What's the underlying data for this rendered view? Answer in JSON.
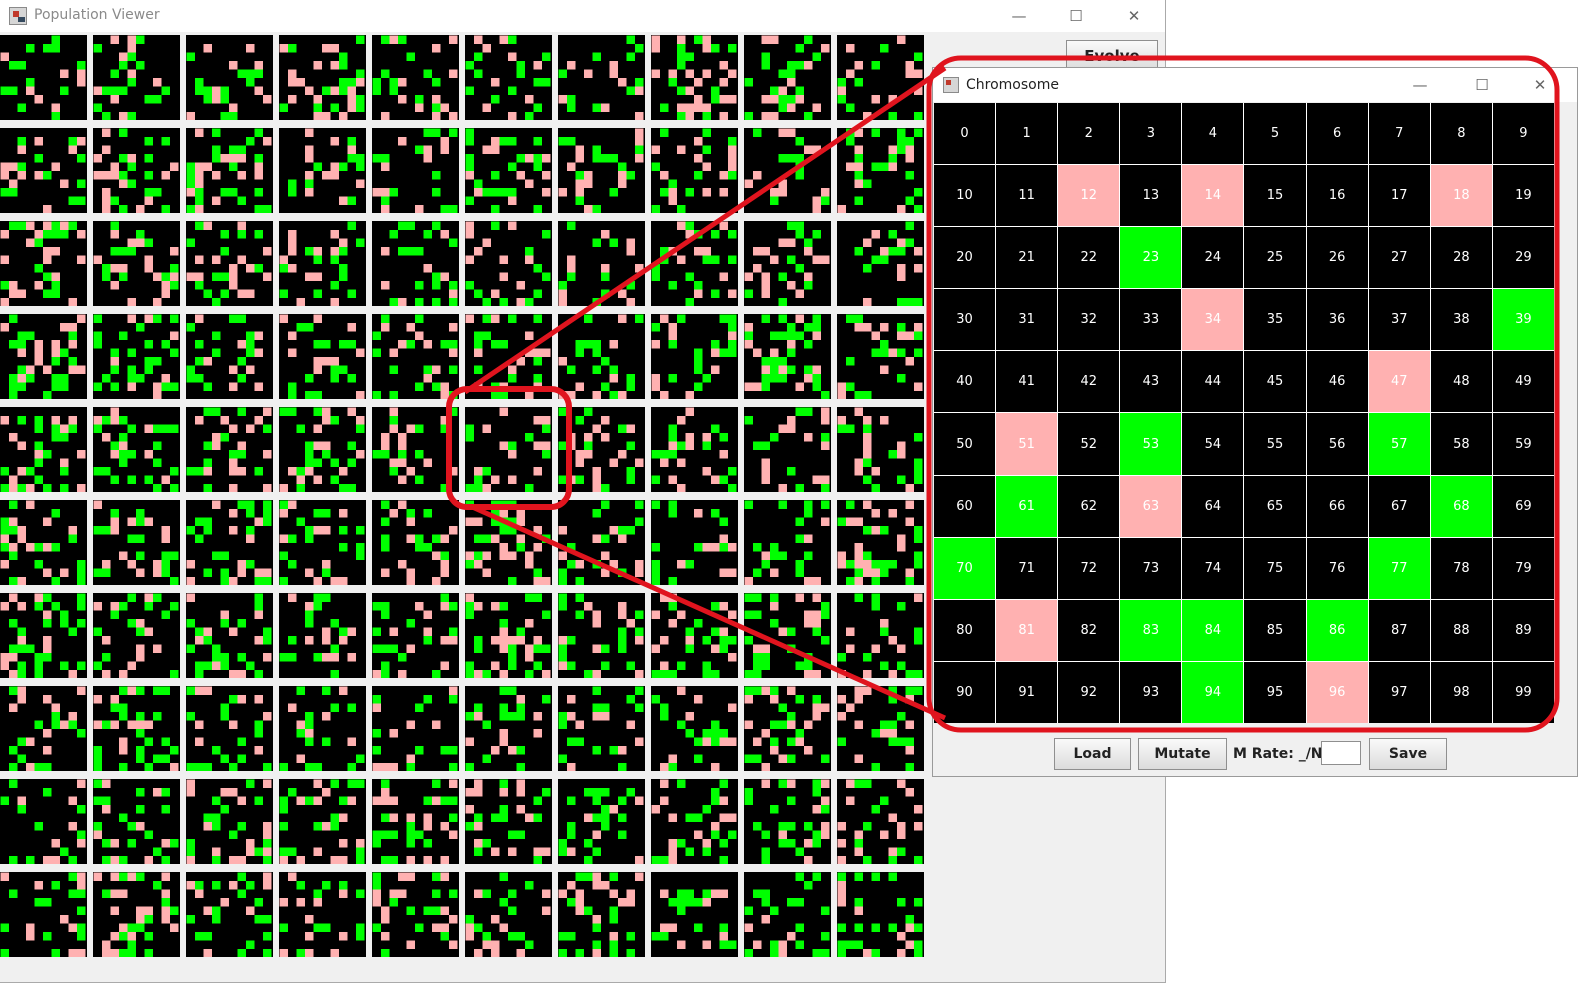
{
  "population_viewer": {
    "title": "Population Viewer",
    "evolve_label": "Evolve",
    "minimize": "—",
    "maximize": "☐",
    "close": "✕",
    "grid": {
      "rows": 10,
      "cols": 10,
      "pink": "#ffb1b1",
      "green": "#00ff00",
      "background": "#000000"
    }
  },
  "chromosome": {
    "title": "Chromosome",
    "minimize": "—",
    "maximize": "☐",
    "close": "✕",
    "colors": {
      "empty": "#000000",
      "pink": "#ffb1b1",
      "green": "#00ff00",
      "text": "#ffffff"
    },
    "pink_cells": [
      12,
      14,
      18,
      34,
      47,
      51,
      63,
      81,
      96
    ],
    "green_cells": [
      23,
      39,
      53,
      57,
      61,
      68,
      70,
      77,
      83,
      84,
      86,
      94
    ],
    "genes": [
      "0",
      "1",
      "2",
      "3",
      "4",
      "5",
      "6",
      "7",
      "8",
      "9",
      "10",
      "11",
      "12",
      "13",
      "14",
      "15",
      "16",
      "17",
      "18",
      "19",
      "20",
      "21",
      "22",
      "23",
      "24",
      "25",
      "26",
      "27",
      "28",
      "29",
      "30",
      "31",
      "32",
      "33",
      "34",
      "35",
      "36",
      "37",
      "38",
      "39",
      "40",
      "41",
      "42",
      "43",
      "44",
      "45",
      "46",
      "47",
      "48",
      "49",
      "50",
      "51",
      "52",
      "53",
      "54",
      "55",
      "56",
      "57",
      "58",
      "59",
      "60",
      "61",
      "62",
      "63",
      "64",
      "65",
      "66",
      "67",
      "68",
      "69",
      "70",
      "71",
      "72",
      "73",
      "74",
      "75",
      "76",
      "77",
      "78",
      "79",
      "80",
      "81",
      "82",
      "83",
      "84",
      "85",
      "86",
      "87",
      "88",
      "89",
      "90",
      "91",
      "92",
      "93",
      "94",
      "95",
      "96",
      "97",
      "98",
      "99"
    ],
    "load_label": "Load",
    "mutate_label": "Mutate",
    "mrate_label": "M Rate: _/N",
    "mrate_value": "",
    "save_label": "Save"
  },
  "annotation": {
    "color": "#e0141e"
  }
}
